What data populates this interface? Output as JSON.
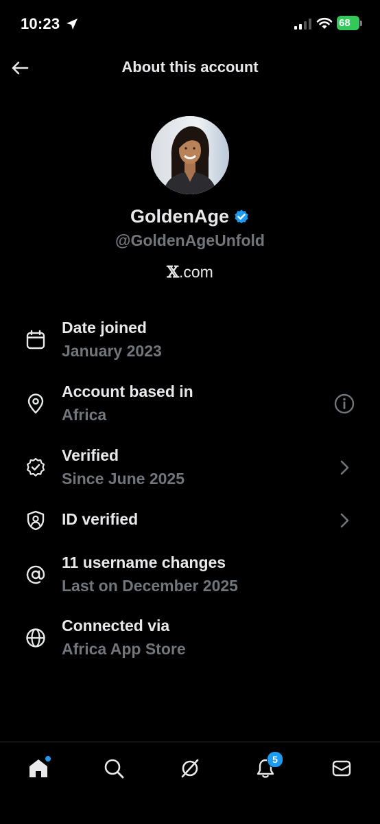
{
  "status_bar": {
    "time": "10:23",
    "battery": "68"
  },
  "header": {
    "title": "About this account"
  },
  "profile": {
    "display_name": "GoldenAge",
    "handle": "@GoldenAgeUnfold",
    "site_mark": "𝕏",
    "site_suffix": ".com",
    "verified": true
  },
  "info_items": [
    {
      "icon": "calendar-icon",
      "title": "Date joined",
      "subtitle": "January 2023"
    },
    {
      "icon": "location-pin-icon",
      "title": "Account based in",
      "subtitle": "Africa",
      "trailing": "info-icon"
    },
    {
      "icon": "verified-seal-icon",
      "title": "Verified",
      "subtitle": "Since June 2025",
      "trailing": "chevron-right-icon"
    },
    {
      "icon": "id-shield-icon",
      "title": "ID verified",
      "trailing": "chevron-right-icon"
    },
    {
      "icon": "at-sign-icon",
      "title": "11 username changes",
      "subtitle": "Last on December 2025"
    },
    {
      "icon": "globe-icon",
      "title": "Connected via",
      "subtitle": "Africa App Store"
    }
  ],
  "bottom_nav": {
    "items": [
      "home-icon",
      "search-icon",
      "grok-icon",
      "bell-icon",
      "mail-icon"
    ],
    "notifications_count": "5"
  },
  "colors": {
    "background": "#000000",
    "primary_text": "#e7e9ea",
    "secondary_text": "#71767b",
    "accent": "#1d9bf0",
    "battery": "#34c759"
  }
}
